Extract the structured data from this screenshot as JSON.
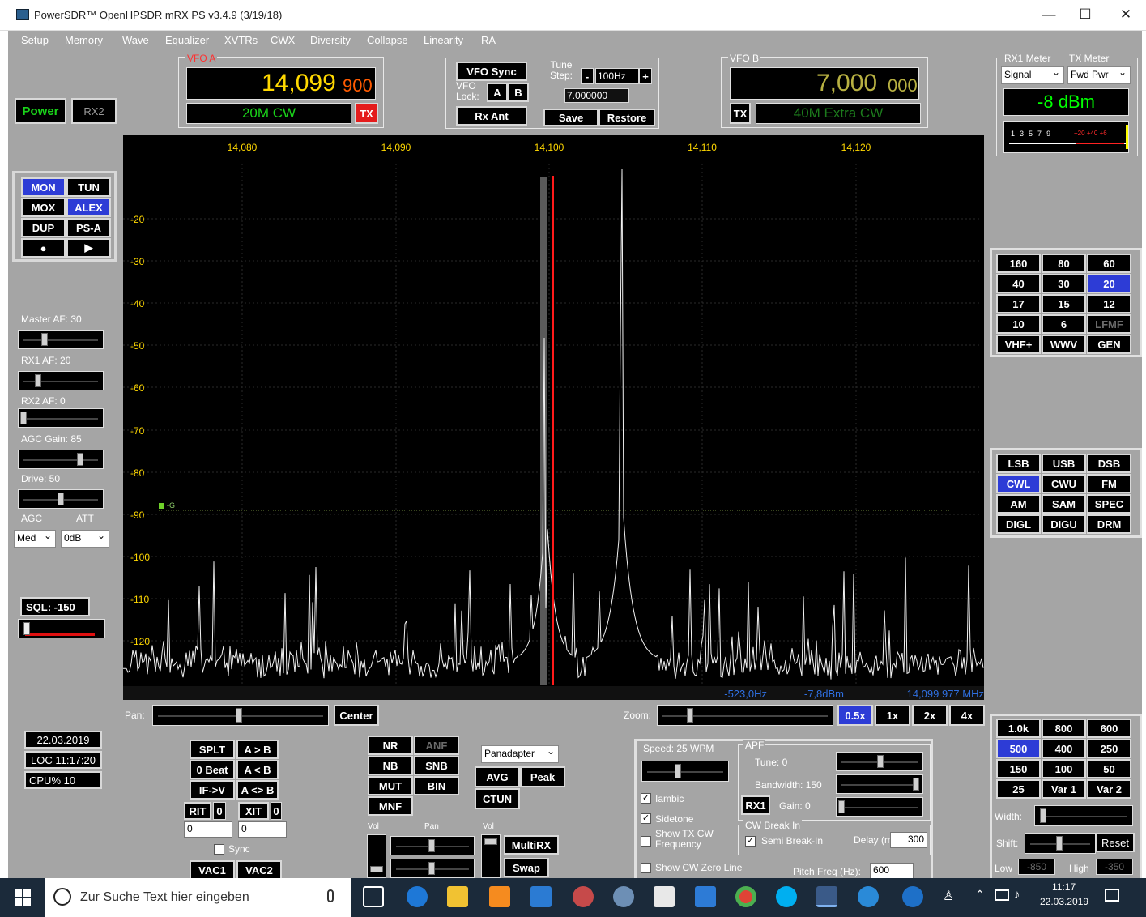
{
  "window": {
    "title": "PowerSDR™ OpenHPSDR mRX PS v3.4.9 (3/19/18)",
    "min": "—",
    "max": "☐",
    "close": "✕"
  },
  "menu": [
    "Setup",
    "Memory",
    "Wave",
    "Equalizer",
    "XVTRs",
    "CWX",
    "Diversity",
    "Collapse",
    "Linearity",
    "RA"
  ],
  "power": {
    "power_label": "Power",
    "rx2_label": "RX2"
  },
  "vfoa": {
    "title": "VFO A",
    "freq_main": "14,099",
    "freq_sub": "900",
    "band": "20M CW",
    "tx": "TX"
  },
  "vfomid": {
    "sync": "VFO Sync",
    "lock_label": "VFO Lock:",
    "a": "A",
    "b": "B",
    "tune_label": "Tune Step:",
    "minus": "-",
    "step": "100Hz",
    "plus": "+",
    "value": "7.000000",
    "rxant": "Rx Ant",
    "save": "Save",
    "restore": "Restore"
  },
  "vfob": {
    "title": "VFO B",
    "freq_main": "7,000",
    "freq_sub": "000",
    "tx": "TX",
    "band": "40M Extra CW"
  },
  "meter": {
    "rx1_label": "RX1 Meter",
    "tx_label": "TX Meter",
    "rx1_sel": "Signal",
    "tx_sel": "Fwd Pwr",
    "reading": "-8 dBm",
    "scale_white": [
      "1",
      "3",
      "5",
      "7",
      "9"
    ],
    "scale_red": [
      "+20",
      "+40",
      "+6"
    ]
  },
  "tx_buttons": [
    [
      "MON",
      "TUN"
    ],
    [
      "MOX",
      "ALEX"
    ],
    [
      "DUP",
      "PS-A"
    ],
    [
      "●",
      "▶"
    ]
  ],
  "sliders": {
    "master_af": "Master AF:  30",
    "rx1_af": "RX1 AF:  20",
    "rx2_af": "RX2 AF:  0",
    "agc_gain": "AGC Gain:  85",
    "drive": "Drive:  50",
    "agc_label": "AGC",
    "att_label": "ATT",
    "agc_sel": "Med",
    "att_sel": "0dB",
    "sql": "SQL: -150"
  },
  "status": {
    "date": "22.03.2019",
    "loc": "LOC 11:17:20",
    "cpu": "CPU%  10"
  },
  "panadapter": {
    "freq_labels": [
      "14,080",
      "14,090",
      "14,100",
      "14,110",
      "14,120"
    ],
    "db_labels": [
      "-20",
      "-30",
      "-40",
      "-50",
      "-60",
      "-70",
      "-80",
      "-90",
      "-100",
      "-110",
      "-120"
    ],
    "gain_marker": "-G",
    "readout": [
      "-523,0Hz",
      "-7,8dBm",
      "14,099 977 MHz"
    ]
  },
  "pan": {
    "label": "Pan:",
    "center": "Center"
  },
  "zoom": {
    "label": "Zoom:",
    "options": [
      "0.5x",
      "1x",
      "2x",
      "4x"
    ]
  },
  "bands": [
    "160",
    "80",
    "60",
    "40",
    "30",
    "20",
    "17",
    "15",
    "12",
    "10",
    "6",
    "LFMF",
    "VHF+",
    "WWV",
    "GEN"
  ],
  "modes": [
    "LSB",
    "USB",
    "DSB",
    "CWL",
    "CWU",
    "FM",
    "AM",
    "SAM",
    "SPEC",
    "DIGL",
    "DIGU",
    "DRM"
  ],
  "filters": [
    "1.0k",
    "800",
    "600",
    "500",
    "400",
    "250",
    "150",
    "100",
    "50",
    "25",
    "Var 1",
    "Var 2"
  ],
  "filter_ctl": {
    "width": "Width:",
    "shift": "Shift:",
    "reset": "Reset",
    "low": "Low",
    "low_val": "-850",
    "high": "High",
    "high_val": "-350"
  },
  "vfo_ops": {
    "splt": "SPLT",
    "atob": "A > B",
    "zerobeat": "0 Beat",
    "btoa": "A < B",
    "ifv": "IF->V",
    "swap": "A <> B",
    "rit": "RIT",
    "rit_val": "0",
    "xit": "XIT",
    "xit_val": "0",
    "rit_num": "0",
    "xit_num": "0",
    "sync": "Sync",
    "vac1": "VAC1",
    "vac2": "VAC2"
  },
  "dsp": {
    "nr": "NR",
    "anf": "ANF",
    "nb": "NB",
    "snb": "SNB",
    "mut": "MUT",
    "bin": "BIN",
    "mnf": "MNF"
  },
  "display_ctl": {
    "mode_sel": "Panadapter",
    "avg": "AVG",
    "peak": "Peak",
    "ctun": "CTUN"
  },
  "vol": {
    "vol1": "Vol",
    "pan": "Pan",
    "vol2": "Vol",
    "multirx": "MultiRX",
    "swap": "Swap"
  },
  "cw": {
    "speed": "Speed:  25 WPM",
    "iambic": "Iambic",
    "sidetone": "Sidetone",
    "showtx": "Show TX CW Frequency",
    "showzero": "Show CW Zero Line",
    "apf": "APF",
    "tune": "Tune:  0",
    "bandwidth": "Bandwidth:  150",
    "rx1": "RX1",
    "gain": "Gain:  0",
    "breakin": "CW Break In",
    "semi": "Semi Break-In",
    "delay": "Delay (ms)",
    "delay_val": "300",
    "pitch": "Pitch Freq (Hz):",
    "pitch_val": "600"
  },
  "taskbar": {
    "search": "Zur Suche Text hier eingeben",
    "time": "11:17",
    "date": "22.03.2019"
  },
  "colors": {
    "vfo_green": "#1ad31a",
    "vfo_yellow": "#ffd800",
    "vfo_orange": "#ff5a00",
    "selected": "#2d3cd6",
    "meter_green": "#00ff00"
  }
}
